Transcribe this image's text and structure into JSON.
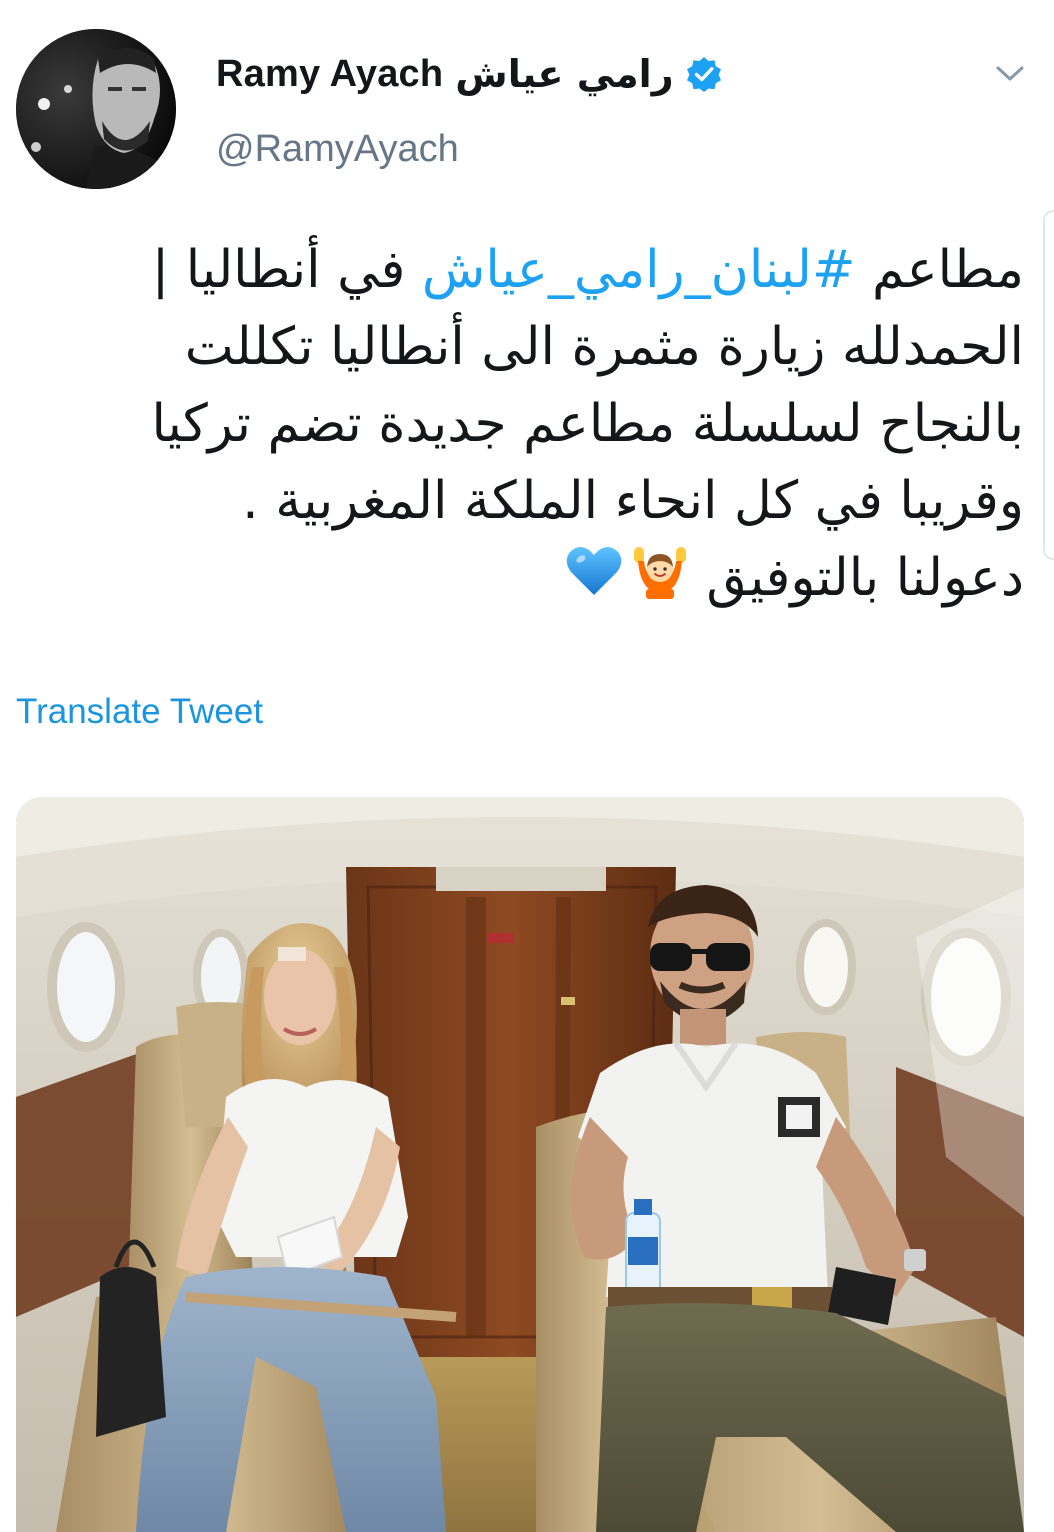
{
  "author": {
    "display_name_latin": "Ramy Ayach",
    "display_name_arabic": "رامي عياش",
    "handle": "@RamyAyach",
    "verified": true
  },
  "tweet": {
    "lines": [
      {
        "before": "مطاعم ",
        "hashtag": "#لبنان_رامي_عياش",
        "after": " في أنطاليا |"
      },
      {
        "text": "الحمدلله زيارة مثمرة الى أنطاليا تكللت"
      },
      {
        "text": "بالنجاح  لسلسلة مطاعم جديدة تضم تركيا"
      },
      {
        "text": "وقريبا في كل انحاء الملكة المغربية ."
      },
      {
        "text": "دعولنا بالتوفيق "
      }
    ],
    "emojis": [
      "person-raising-hands-icon",
      "blue-heart-icon"
    ],
    "translate_label": "Translate Tweet"
  },
  "colors": {
    "link": "#1da1f2",
    "translate": "#1b95e0",
    "handle": "#657786",
    "verified": "#1da1f2",
    "text": "#14171a"
  }
}
